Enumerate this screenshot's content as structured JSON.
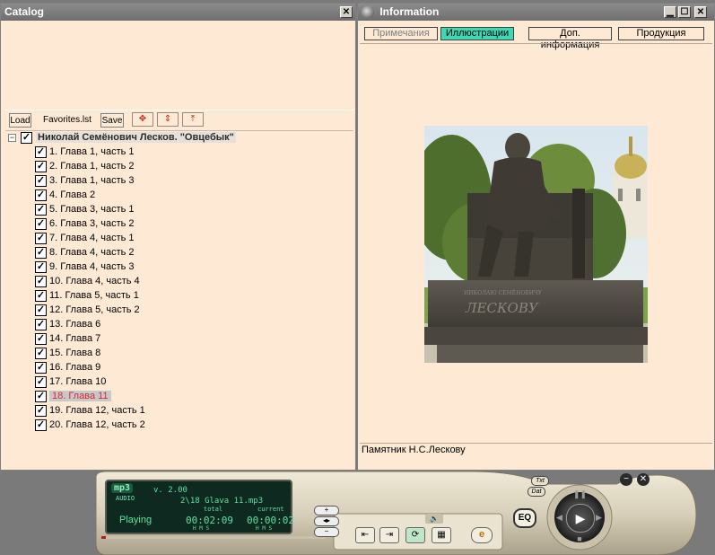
{
  "catalog": {
    "title": "Catalog",
    "close_glyph": "✕",
    "toolbar": {
      "load": "Load",
      "filename": "Favorites.lst",
      "save": "Save"
    },
    "root_label": "Николай Семёнович Лесков. \"Овцебык\"",
    "items": [
      "1. Глава 1, часть 1",
      "2. Глава 1, часть 2",
      "3. Глава 1, часть 3",
      "4. Глава 2",
      "5. Глава 3, часть 1",
      "6. Глава 3, часть 2",
      "7. Глава 4, часть 1",
      "8. Глава 4, часть 2",
      "9. Глава 4, часть 3",
      "10. Глава 4, часть 4",
      "11. Глава 5, часть 1",
      "12. Глава 5, часть 2",
      "13. Глава 6",
      "14. Глава 7",
      "15. Глава 8",
      "16. Глава 9",
      "17. Глава 10",
      "18. Глава 11",
      "19. Глава 12, часть 1",
      "20. Глава 12, часть 2"
    ],
    "selected_index": 17
  },
  "information": {
    "title": "Information",
    "tabs": [
      "Примечания",
      "Иллюстрации",
      "Доп. информация",
      "Продукция"
    ],
    "caption": "Памятник Н.С.Лескову",
    "photo_inscription": "ЛЕСКОВУ"
  },
  "player": {
    "logo": "mp3",
    "logo_sub": "AUDIO",
    "version": "v. 2.00",
    "track": "2\\18 Glava 11.mp3",
    "status": "Playing",
    "total_label": "total",
    "current_label": "current",
    "total_time": "00:02:09",
    "current_time": "00:00:02",
    "hms": "H M S",
    "eq": "EQ",
    "txt": "Txt",
    "dat": "Dat",
    "progress": 0.02
  },
  "colors": {
    "window_bg": "#fde9d4",
    "active_tab": "#3ed9b4",
    "selected_text": "#d8283a",
    "lcd_text": "#5fe0a0"
  }
}
